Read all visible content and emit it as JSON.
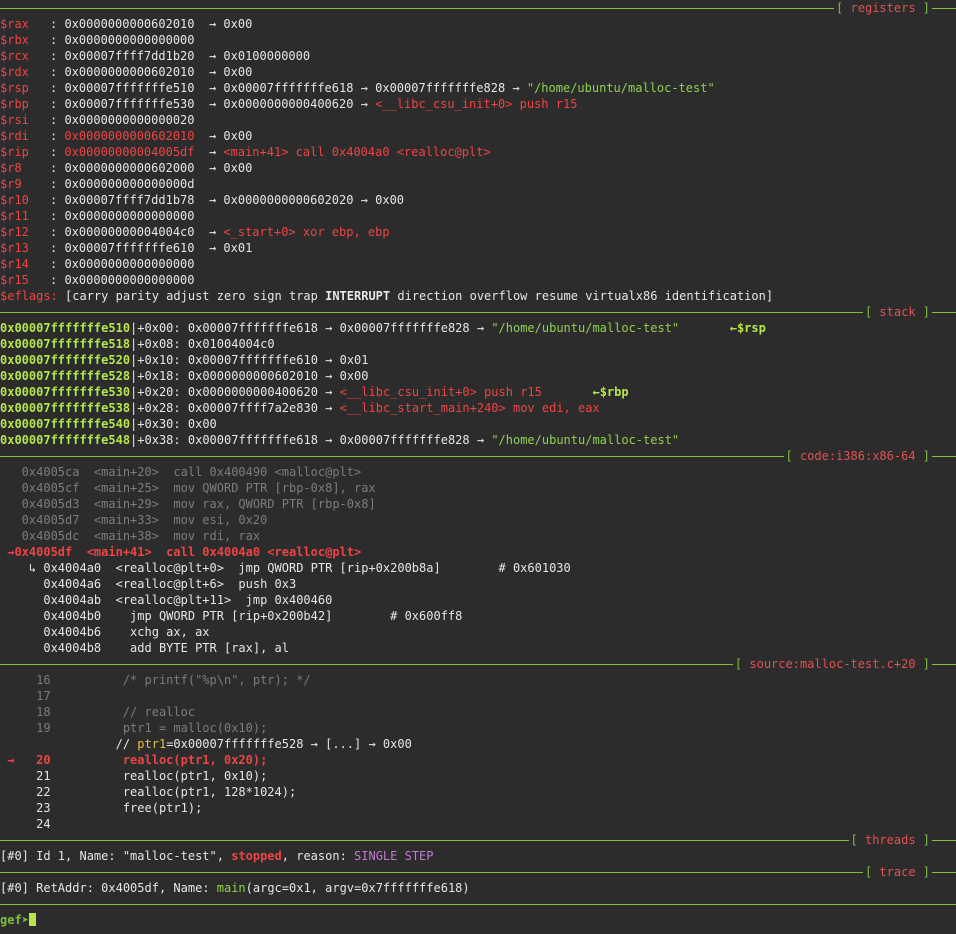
{
  "sections": {
    "registers": "registers",
    "stack": "stack",
    "code": "code:i386:x86-64",
    "source": "source:malloc-test.c+20",
    "threads": "threads",
    "trace": "trace"
  },
  "registers": [
    {
      "name": "$rax",
      "value": "0x0000000000602010",
      "chain": "→ 0x00",
      "changed": false,
      "chain_color": "white"
    },
    {
      "name": "$rbx",
      "value": "0x0000000000000000",
      "chain": "",
      "changed": false,
      "chain_color": "white"
    },
    {
      "name": "$rcx",
      "value": "0x00007ffff7dd1b20",
      "chain": "→ 0x0100000000",
      "changed": false,
      "chain_color": "white"
    },
    {
      "name": "$rdx",
      "value": "0x0000000000602010",
      "chain": "→ 0x00",
      "changed": false,
      "chain_color": "white"
    },
    {
      "name": "$rsp",
      "value": "0x00007fffffffe510",
      "chain": "→ 0x00007fffffffe618 → 0x00007fffffffe828 → ",
      "extra": "\"/home/ubuntu/malloc-test\"",
      "extra_color": "green",
      "changed": false
    },
    {
      "name": "$rbp",
      "value": "0x00007fffffffe530",
      "chain": "→ 0x0000000000400620 → ",
      "extra": "<__libc_csu_init+0> push r15",
      "extra_color": "red",
      "changed": false
    },
    {
      "name": "$rsi",
      "value": "0x0000000000000020",
      "chain": "",
      "changed": false
    },
    {
      "name": "$rdi",
      "value": "0x0000000000602010",
      "chain": "→ 0x00",
      "changed": true
    },
    {
      "name": "$rip",
      "value": "0x00000000004005df",
      "chain": "→ ",
      "extra": "<main+41> call 0x4004a0 <realloc@plt>",
      "extra_color": "red",
      "changed": true
    },
    {
      "name": "$r8",
      "value": "0x0000000000602000",
      "chain": "→ 0x00",
      "changed": false
    },
    {
      "name": "$r9",
      "value": "0x000000000000000d",
      "chain": "",
      "changed": false
    },
    {
      "name": "$r10",
      "value": "0x00007ffff7dd1b78",
      "chain": "→ 0x0000000000602020 → 0x00",
      "changed": false
    },
    {
      "name": "$r11",
      "value": "0x0000000000000000",
      "chain": "",
      "changed": false
    },
    {
      "name": "$r12",
      "value": "0x00000000004004c0",
      "chain": "→ ",
      "extra": "<_start+0> xor ebp, ebp",
      "extra_color": "red",
      "changed": false
    },
    {
      "name": "$r13",
      "value": "0x00007fffffffe610",
      "chain": "→ 0x01",
      "changed": false
    },
    {
      "name": "$r14",
      "value": "0x0000000000000000",
      "chain": "",
      "changed": false
    },
    {
      "name": "$r15",
      "value": "0x0000000000000000",
      "chain": "",
      "changed": false
    }
  ],
  "eflags": {
    "name": "$eflags:",
    "before": " [carry parity adjust zero sign trap ",
    "bold": "INTERRUPT",
    "after": " direction overflow resume virtualx86 identification]"
  },
  "stack": [
    {
      "addr": "0x00007fffffffe510",
      "off": "+0x00:",
      "val": "0x00007fffffffe618 → 0x00007fffffffe828 → ",
      "extra": "\"/home/ubuntu/malloc-test\"",
      "extra_color": "green",
      "marker": "←$rsp"
    },
    {
      "addr": "0x00007fffffffe518",
      "off": "+0x08:",
      "val": "0x01004004c0",
      "extra": "",
      "marker": ""
    },
    {
      "addr": "0x00007fffffffe520",
      "off": "+0x10:",
      "val": "0x00007fffffffe610 → 0x01",
      "extra": "",
      "marker": ""
    },
    {
      "addr": "0x00007fffffffe528",
      "off": "+0x18:",
      "val": "0x0000000000602010 → 0x00",
      "extra": "",
      "marker": ""
    },
    {
      "addr": "0x00007fffffffe530",
      "off": "+0x20:",
      "val": "0x0000000000400620 → ",
      "extra": "<__libc_csu_init+0> push r15",
      "extra_color": "red",
      "marker": "←$rbp"
    },
    {
      "addr": "0x00007fffffffe538",
      "off": "+0x28:",
      "val": "0x00007ffff7a2e830 → ",
      "extra": "<__libc_start_main+240> mov edi, eax",
      "extra_color": "red",
      "marker": ""
    },
    {
      "addr": "0x00007fffffffe540",
      "off": "+0x30:",
      "val": "0x00",
      "extra": "",
      "marker": ""
    },
    {
      "addr": "0x00007fffffffe548",
      "off": "+0x38:",
      "val": "0x00007fffffffe618 → 0x00007fffffffe828 → ",
      "extra": "\"/home/ubuntu/malloc-test\"",
      "extra_color": "green",
      "marker": ""
    }
  ],
  "code": [
    {
      "text": "   0x4005ca  <main+20>  call 0x400490 <malloc@plt>",
      "style": "grey"
    },
    {
      "text": "   0x4005cf  <main+25>  mov QWORD PTR [rbp-0x8], rax",
      "style": "grey"
    },
    {
      "text": "   0x4005d3  <main+29>  mov rax, QWORD PTR [rbp-0x8]",
      "style": "grey"
    },
    {
      "text": "   0x4005d7  <main+33>  mov esi, 0x20",
      "style": "grey"
    },
    {
      "text": "   0x4005dc  <main+38>  mov rdi, rax",
      "style": "grey"
    },
    {
      "text": " →0x4005df  <main+41>  call 0x4004a0 <realloc@plt>",
      "style": "cur"
    },
    {
      "text": "    ↳ 0x4004a0  <realloc@plt+0>  jmp QWORD PTR [rip+0x200b8a]        # 0x601030",
      "style": "white"
    },
    {
      "text": "      0x4004a6  <realloc@plt+6>  push 0x3",
      "style": "white"
    },
    {
      "text": "      0x4004ab  <realloc@plt+11>  jmp 0x400460",
      "style": "white"
    },
    {
      "text": "      0x4004b0    jmp QWORD PTR [rip+0x200b42]        # 0x600ff8",
      "style": "white"
    },
    {
      "text": "      0x4004b6    xchg ax, ax",
      "style": "white"
    },
    {
      "text": "      0x4004b8    add BYTE PTR [rax], al",
      "style": "white"
    }
  ],
  "source": [
    {
      "text": "     16          /* printf(\"%p\\n\", ptr); */",
      "style": "grey"
    },
    {
      "text": "     17",
      "style": "grey"
    },
    {
      "text": "     18          // realloc",
      "style": "grey"
    },
    {
      "text": "     19          ptr1 = malloc(0x10);",
      "style": "grey"
    },
    {
      "text": "",
      "style": "ptrline"
    },
    {
      "text": " →   20          realloc(ptr1, 0x20);",
      "style": "cur"
    },
    {
      "text": "     21          realloc(ptr1, 0x10);",
      "style": "white"
    },
    {
      "text": "     22          realloc(ptr1, 128*1024);",
      "style": "white"
    },
    {
      "text": "     23          free(ptr1);",
      "style": "white"
    },
    {
      "text": "     24",
      "style": "white"
    }
  ],
  "ptrline": {
    "prefix": "                // ",
    "var": "ptr1",
    "rest": "=0x00007fffffffe528 → [...] → 0x00"
  },
  "threads": {
    "prefix": "[#0] Id 1, Name: \"malloc-test\", ",
    "state": "stopped",
    "mid": ", reason: ",
    "reason": "SINGLE STEP"
  },
  "trace": {
    "prefix": "[#0] RetAddr: 0x4005df, Name: ",
    "func": "main",
    "rest": "(argc=0x1, argv=0x7fffffffe618)"
  },
  "prompt": "gef➤"
}
